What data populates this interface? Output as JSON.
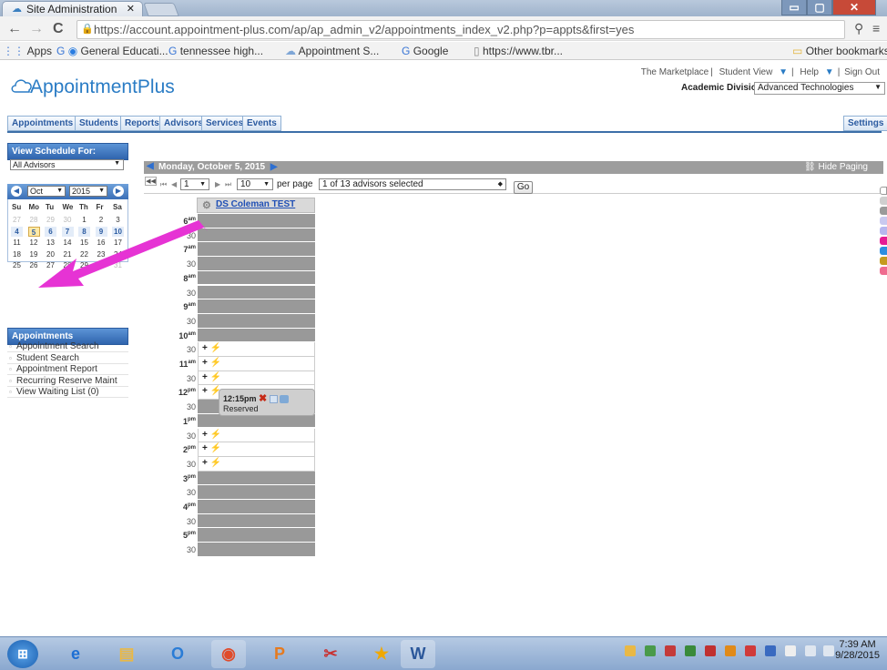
{
  "browser": {
    "tab_title": "Site Administration",
    "url": "https://account.appointment-plus.com/ap/ap_admin_v2/appointments_index_v2.php?p=appts&first=yes",
    "bookmarks": [
      "Apps",
      "General Educati...",
      "tennessee high...",
      "Appointment S...",
      "Google",
      "https://www.tbr..."
    ],
    "other_bookmarks": "Other bookmarks"
  },
  "app": {
    "logo": "AppointmentPlus",
    "top_links": [
      "The Marketplace",
      "Student View",
      "Help",
      "Sign Out"
    ],
    "division_label": "Academic Division",
    "division_value": "Advanced Technologies",
    "tabs": [
      "Appointments",
      "Students",
      "Reports",
      "Advisors",
      "Services",
      "Events"
    ],
    "settings_label": "Settings"
  },
  "left": {
    "view_schedule_label": "View Schedule For:",
    "advisor_select": "All Advisors",
    "cal_month": "Oct",
    "cal_year": "2015",
    "cal_days_header": [
      "Su",
      "Mo",
      "Tu",
      "We",
      "Th",
      "Fr",
      "Sa"
    ],
    "cal_weeks": [
      [
        "27",
        "28",
        "29",
        "30",
        "1",
        "2",
        "3"
      ],
      [
        "4",
        "5",
        "6",
        "7",
        "8",
        "9",
        "10"
      ],
      [
        "11",
        "12",
        "13",
        "14",
        "15",
        "16",
        "17"
      ],
      [
        "18",
        "19",
        "20",
        "21",
        "22",
        "23",
        "24"
      ],
      [
        "25",
        "26",
        "27",
        "28",
        "29",
        "30",
        "31"
      ]
    ],
    "appointments_header": "Appointments",
    "appointment_links": [
      "Appointment Search",
      "Student Search",
      "Appointment Report",
      "Recurring Reserve Maint",
      "View Waiting List (0)"
    ]
  },
  "schedule": {
    "date": "Monday, October 5, 2015",
    "hide_paging": "Hide Paging",
    "page_value": "1",
    "per_page_value": "10",
    "per_page_label": "per page",
    "advisors_selected": "1 of 13 advisors selected",
    "go_label": "Go",
    "advisor_name": "DS Coleman TEST",
    "time_labels": [
      {
        "t": "6",
        "s": "am",
        "h": true
      },
      {
        "t": "30"
      },
      {
        "t": "7",
        "s": "am",
        "h": true
      },
      {
        "t": "30"
      },
      {
        "t": "8",
        "s": "am",
        "h": true
      },
      {
        "t": "30"
      },
      {
        "t": "9",
        "s": "am",
        "h": true
      },
      {
        "t": "30"
      },
      {
        "t": "10",
        "s": "am",
        "h": true
      },
      {
        "t": "30"
      },
      {
        "t": "11",
        "s": "am",
        "h": true
      },
      {
        "t": "30"
      },
      {
        "t": "12",
        "s": "pm",
        "h": true
      },
      {
        "t": "30"
      },
      {
        "t": "1",
        "s": "pm",
        "h": true
      },
      {
        "t": "30"
      },
      {
        "t": "2",
        "s": "pm",
        "h": true
      },
      {
        "t": "30"
      },
      {
        "t": "3",
        "s": "pm",
        "h": true
      },
      {
        "t": "30"
      },
      {
        "t": "4",
        "s": "pm",
        "h": true
      },
      {
        "t": "30"
      },
      {
        "t": "5",
        "s": "pm",
        "h": true
      },
      {
        "t": "30"
      }
    ],
    "open_slots": [
      9,
      10,
      11,
      12,
      15,
      16,
      17
    ],
    "slot_controls": "+ ⚡",
    "appointment": {
      "time": "12:15pm",
      "status": "Reserved"
    }
  },
  "taskbar": {
    "time": "7:39 AM",
    "date": "9/28/2015"
  }
}
